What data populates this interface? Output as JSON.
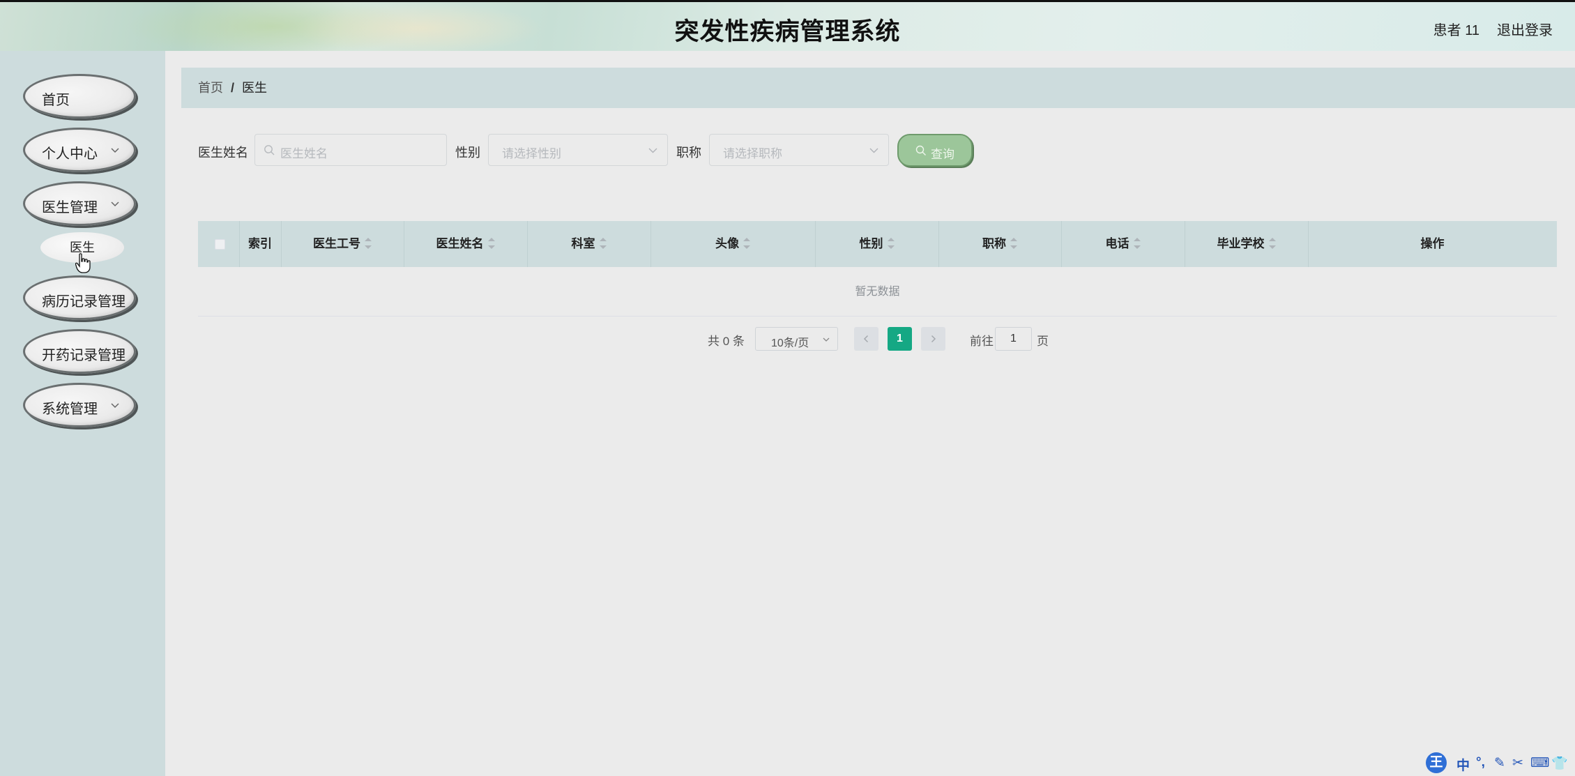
{
  "header": {
    "title": "突发性疾病管理系统",
    "user": "患者 11",
    "logout": "退出登录"
  },
  "sidebar": {
    "items": [
      {
        "label": "首页",
        "has_children": false
      },
      {
        "label": "个人中心",
        "has_children": true
      },
      {
        "label": "医生管理",
        "has_children": true
      },
      {
        "label": "病历记录管理",
        "has_children": false
      },
      {
        "label": "开药记录管理",
        "has_children": false
      },
      {
        "label": "系统管理",
        "has_children": true
      }
    ],
    "submenu": {
      "label": "医生",
      "parent": "医生管理"
    }
  },
  "breadcrumb": {
    "home": "首页",
    "separator": "/",
    "current": "医生"
  },
  "search": {
    "name_label": "医生姓名",
    "name_placeholder": "医生姓名",
    "gender_label": "性别",
    "gender_placeholder": "请选择性别",
    "title_label": "职称",
    "title_placeholder": "请选择职称",
    "query_button": "查询"
  },
  "table": {
    "columns": [
      "索引",
      "医生工号",
      "医生姓名",
      "科室",
      "头像",
      "性别",
      "职称",
      "电话",
      "毕业学校",
      "操作"
    ],
    "sortable": [
      false,
      true,
      true,
      true,
      true,
      true,
      true,
      true,
      true,
      false
    ],
    "empty_text": "暂无数据"
  },
  "pagination": {
    "total": "共 0 条",
    "page_size": "10条/页",
    "current_page": "1",
    "goto_label": "前往",
    "goto_value": "1",
    "unit": "页"
  },
  "ime": {
    "logo": "王",
    "items": [
      "中",
      "°,",
      "✎",
      "✂",
      "⌨",
      "👕"
    ]
  },
  "colors": {
    "accent": "#15a884",
    "sidebar_bg": "#cddcdd",
    "page_bg": "#ebebeb",
    "query_button": "#9cc69a"
  }
}
